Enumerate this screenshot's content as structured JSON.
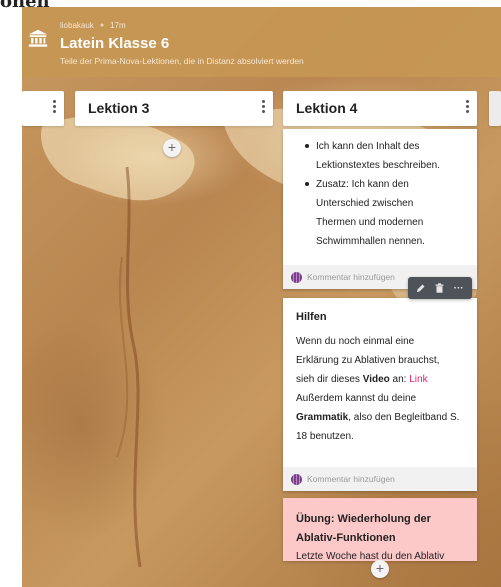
{
  "page_top_strip": {
    "text": "onen"
  },
  "header": {
    "author": "liobakauk",
    "time": "17m",
    "title": "Latein Klasse 6",
    "description": "Teile der Prima-Nova-Lektionen, die in Distanz absolviert werden",
    "logo_icon": "museum-icon"
  },
  "columns": [
    {
      "title": ""
    },
    {
      "title": "Lektion 3"
    },
    {
      "title": "Lektion 4"
    },
    {
      "title": ""
    }
  ],
  "add_post_label": "+",
  "cards": {
    "card1": {
      "bullets": [
        [
          "Ich kann den Inhalt des",
          "Lektionstextes beschreiben."
        ],
        [
          "Zusatz: Ich kann den",
          "Unterschied zwischen",
          "Thermen und modernen",
          "Schwimmhallen nennen."
        ]
      ],
      "comment_placeholder": "Kommentar hinzufügen"
    },
    "card2": {
      "title": "Hilfen",
      "body": {
        "line1": "Wenn du noch einmal eine",
        "line2": "Erklärung zu Ablativen brauchst,",
        "line3_prefix": "sieh dir dieses ",
        "line3_bold": "Video",
        "line3_mid": " an: ",
        "line3_link": "Link",
        "line4": "Außerdem kannst du deine",
        "line5_bold": "Grammatik",
        "line5_rest": ", also den Begleitband S.",
        "line6": "18 benutzen."
      },
      "comment_placeholder": "Kommentar hinzufügen"
    },
    "card3": {
      "title": "Übung: Wiederholung der Ablativ-Funktionen",
      "body": "Letzte Woche hast du den Ablativ"
    }
  },
  "toolbar": {
    "icons": [
      "pencil-icon",
      "trash-icon",
      "more-icon"
    ],
    "more_label": "···"
  },
  "colors": {
    "header_bg": "#c69654",
    "link": "#e0236a",
    "exercise_card_bg": "#fdc8c8",
    "toolbar_bg": "#4d5358"
  }
}
